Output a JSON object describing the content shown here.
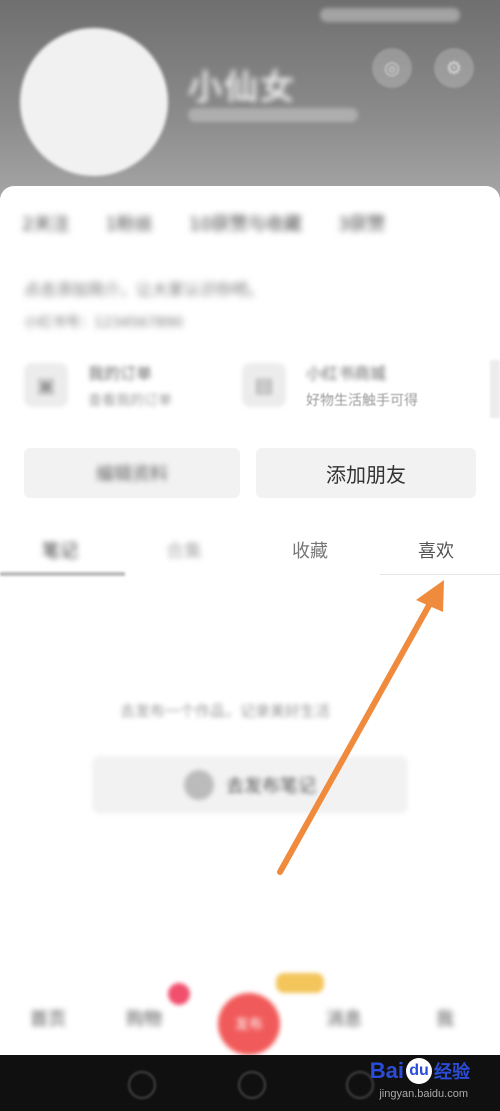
{
  "header": {
    "username": "小仙女",
    "colors": {
      "background": "#8c8c8c"
    }
  },
  "stats": {
    "items": [
      "2关注",
      "1粉丝",
      "10获赞与收藏",
      "3获赞"
    ]
  },
  "bio": {
    "line1": "点击添加简介，让大家认识你吧。",
    "line2": "小红书号：1234567890"
  },
  "services": [
    {
      "icon": "bag-icon",
      "title": "我的订单",
      "subtitle": "查看我的订单"
    },
    {
      "icon": "store-icon",
      "title": "小红书商城",
      "subtitle": "好物生活触手可得"
    }
  ],
  "actions": {
    "edit_profile_label": "编辑资料",
    "add_friend_label": "添加朋友"
  },
  "tabs": [
    {
      "label": "笔记",
      "active": true
    },
    {
      "label": "合集",
      "active": false
    },
    {
      "label": "收藏",
      "active": false
    },
    {
      "label": "喜欢",
      "active": false
    }
  ],
  "empty_state": {
    "text": "去发布一个作品，记录美好生活",
    "publish_label": "去发布笔记"
  },
  "bottom_nav": {
    "home": "首页",
    "shop": "购物",
    "plus": "发布",
    "messages": "消息",
    "me": "我"
  },
  "watermark": {
    "brand": "Bai",
    "brand2": "经验",
    "domain": "jingyan.baidu.com"
  },
  "annotation": {
    "color": "#f08a3c"
  }
}
